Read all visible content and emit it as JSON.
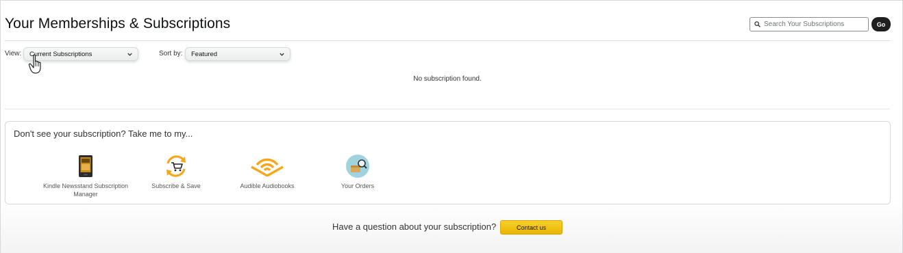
{
  "header": {
    "title": "Your Memberships & Subscriptions",
    "search_placeholder": "Search Your Subscriptions",
    "go_label": "Go"
  },
  "filters": {
    "view_label": "View:",
    "view_value": "Current Subscriptions",
    "sort_label": "Sort by:",
    "sort_value": "Featured"
  },
  "results": {
    "empty_message": "No subscription found."
  },
  "shortcuts": {
    "title": "Don't see your subscription? Take me to my...",
    "items": [
      {
        "label": "Kindle Newsstand Subscription Manager",
        "icon": "kindle-icon"
      },
      {
        "label": "Subscribe & Save",
        "icon": "subscribe-save-icon"
      },
      {
        "label": "Audible Audiobooks",
        "icon": "audible-icon"
      },
      {
        "label": "Your Orders",
        "icon": "orders-icon"
      }
    ]
  },
  "footer": {
    "question": "Have a question about your subscription?",
    "contact_label": "Contact us"
  },
  "colors": {
    "accent_yellow": "#f0c14b",
    "go_button": "#1f1f1f",
    "icon_orange": "#f7a61b",
    "orders_teal": "#9fd4df"
  }
}
